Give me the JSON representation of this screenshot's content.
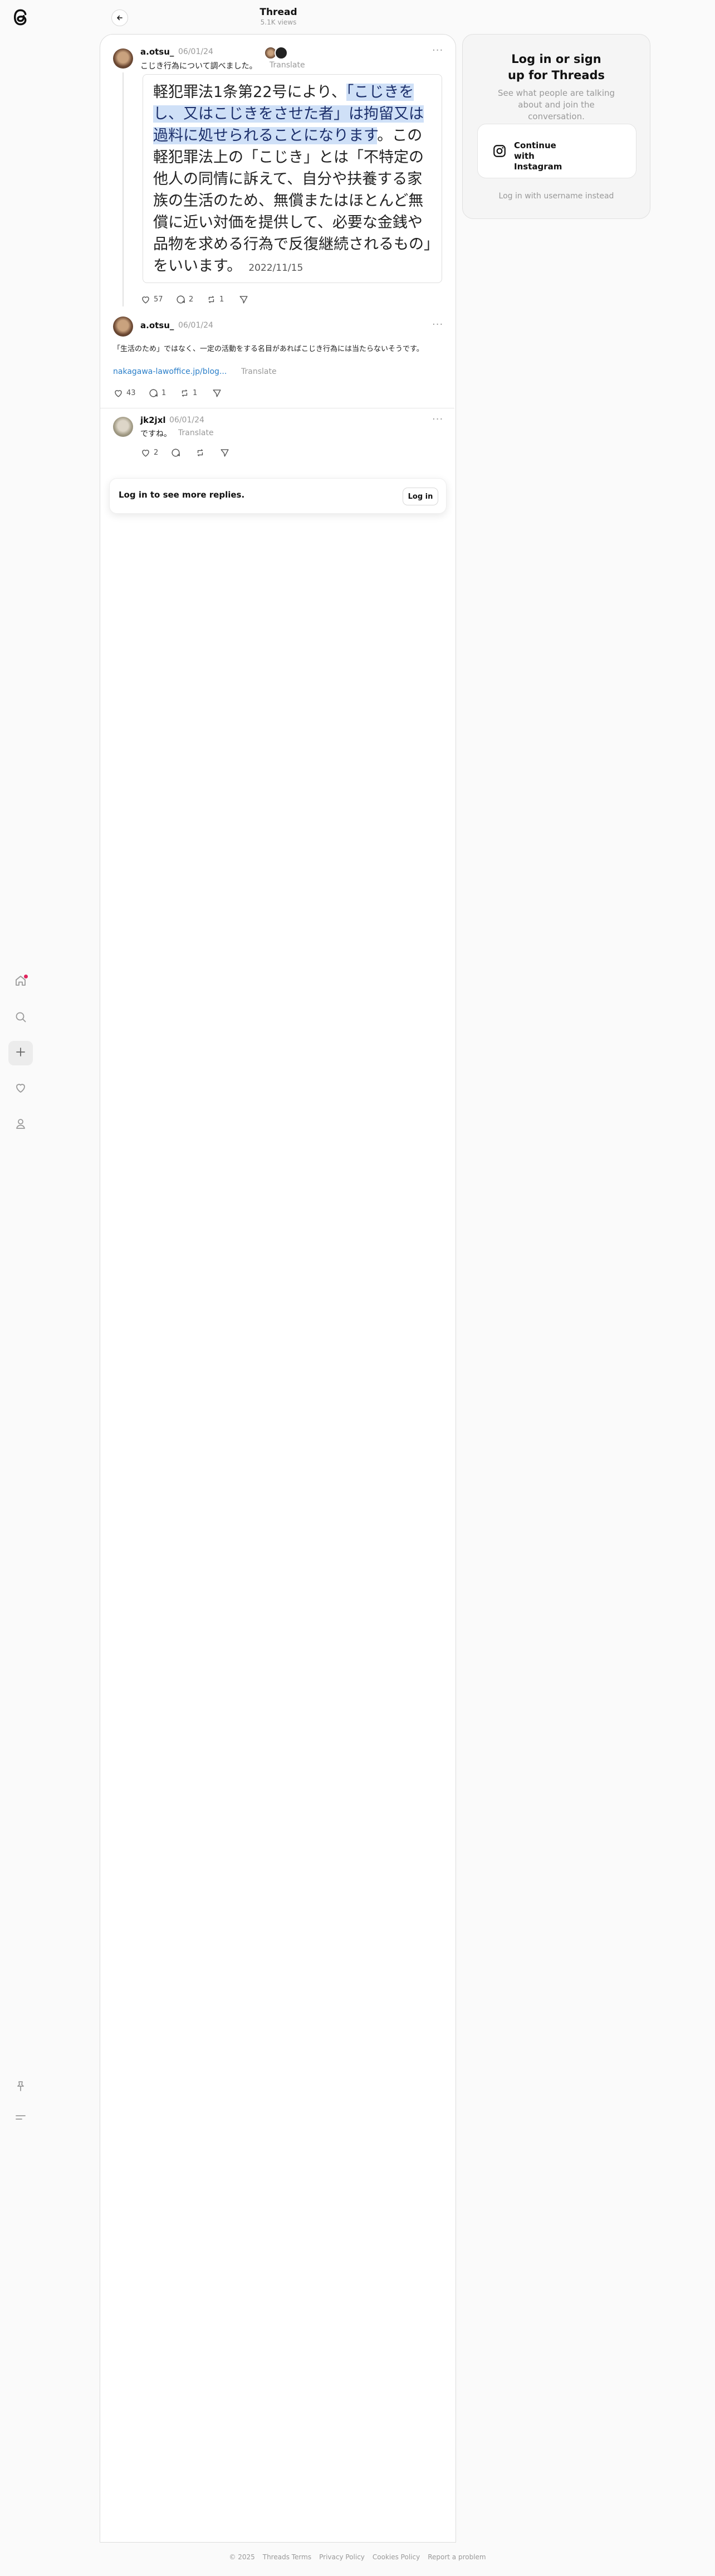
{
  "header": {
    "title": "Thread",
    "subtitle": "5.1K views"
  },
  "nav": {
    "items": [
      {
        "icon": "home-icon",
        "active": false
      },
      {
        "icon": "search-icon",
        "active": false
      },
      {
        "icon": "create-icon",
        "active": true
      },
      {
        "icon": "heart-icon",
        "active": false
      },
      {
        "icon": "profile-icon",
        "active": false
      }
    ],
    "bottom": [
      {
        "icon": "pin-icon"
      },
      {
        "icon": "menu-icon"
      }
    ]
  },
  "posts": [
    {
      "username": "a.otsu_",
      "date": "06/01/24",
      "text": "こじき行為について調べました。",
      "translate": "Translate",
      "quote": {
        "before": "軽犯罪法1条第22号により、",
        "highlight": "「こじきをし、又はこじきをさせた者」は拘留又は過料に処せられることになります",
        "after": "。この軽犯罪法上の「こじき」とは「不特定の他人の同情に訴えて、自分や扶養する家族の生活のため、無償またはほとんど無償に近い対価を提供して、必要な金銭や品物を求める行為で反復継続されるもの」をいいます。",
        "date": "2022/11/15"
      },
      "likes": "57",
      "replies": "2",
      "reposts": "1"
    },
    {
      "username": "a.otsu_",
      "date": "06/01/24",
      "text": "「生活のため」ではなく、一定の活動をする名目があればこじき行為には当たらないそうです。",
      "link": "nakagawa-lawoffice.jp/blog...",
      "translate": "Translate",
      "likes": "43",
      "replies": "1",
      "reposts": "1"
    },
    {
      "username": "jk2jxl",
      "date": "06/01/24",
      "text": "ですね。",
      "translate": "Translate",
      "likes": "2"
    }
  ],
  "login_strip": {
    "text": "Log in to see more replies.",
    "button": "Log in"
  },
  "side": {
    "title": "Log in or sign up for Threads",
    "subtitle": "See what people are talking about and join the conversation.",
    "instagram_button": "Continue with Instagram",
    "username_link": "Log in with username instead"
  },
  "footer": [
    "© 2025",
    "Threads Terms",
    "Privacy Policy",
    "Cookies Policy",
    "Report a problem"
  ],
  "colors": {
    "highlight": "#cfe0f7",
    "link": "#2b7fc9",
    "notification": "#e0245e"
  }
}
